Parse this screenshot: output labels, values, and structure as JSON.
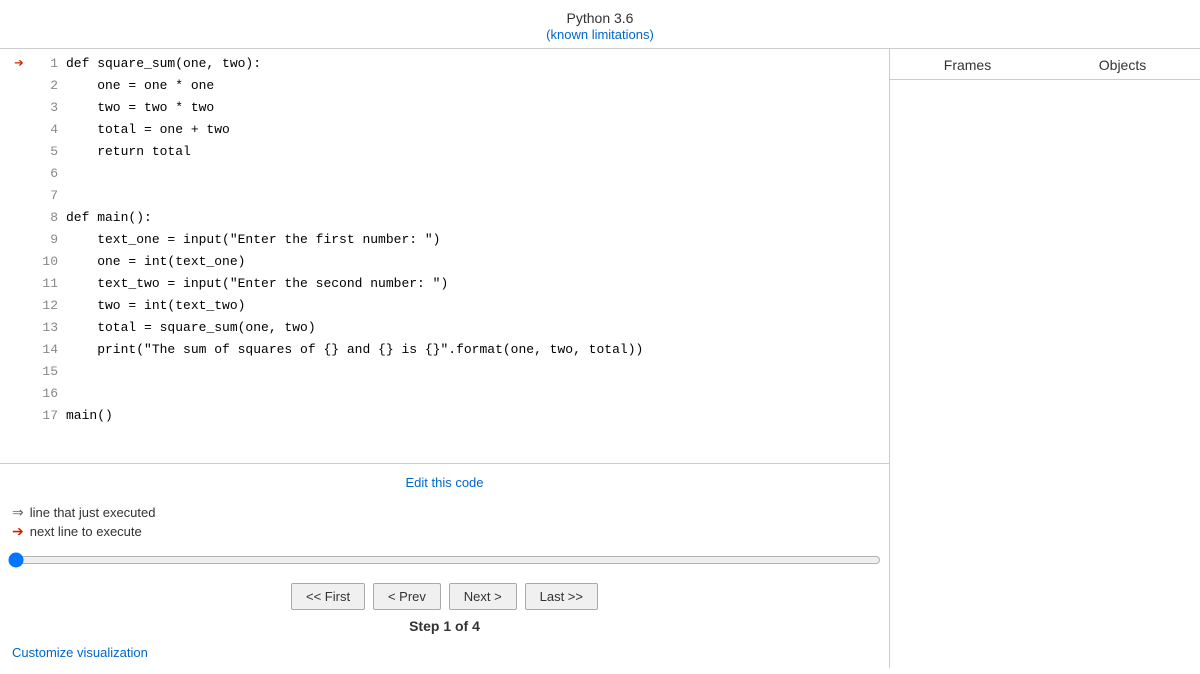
{
  "header": {
    "title": "Python 3.6",
    "limitations_label": "(known limitations)"
  },
  "right_panel": {
    "tab_frames": "Frames",
    "tab_objects": "Objects"
  },
  "code": {
    "lines": [
      {
        "num": 1,
        "content": "def square_sum(one, two):",
        "arrow": "red",
        "id": "line-1"
      },
      {
        "num": 2,
        "content": "    one = one * one",
        "arrow": "",
        "id": "line-2"
      },
      {
        "num": 3,
        "content": "    two = two * two",
        "arrow": "",
        "id": "line-3"
      },
      {
        "num": 4,
        "content": "    total = one + two",
        "arrow": "",
        "id": "line-4"
      },
      {
        "num": 5,
        "content": "    return total",
        "arrow": "",
        "id": "line-5"
      },
      {
        "num": 6,
        "content": "",
        "arrow": "",
        "id": "line-6"
      },
      {
        "num": 7,
        "content": "",
        "arrow": "",
        "id": "line-7"
      },
      {
        "num": 8,
        "content": "def main():",
        "arrow": "",
        "id": "line-8"
      },
      {
        "num": 9,
        "content": "    text_one = input(\"Enter the first number: \")",
        "arrow": "",
        "id": "line-9"
      },
      {
        "num": 10,
        "content": "    one = int(text_one)",
        "arrow": "",
        "id": "line-10"
      },
      {
        "num": 11,
        "content": "    text_two = input(\"Enter the second number: \")",
        "arrow": "",
        "id": "line-11"
      },
      {
        "num": 12,
        "content": "    two = int(text_two)",
        "arrow": "",
        "id": "line-12"
      },
      {
        "num": 13,
        "content": "    total = square_sum(one, two)",
        "arrow": "",
        "id": "line-13"
      },
      {
        "num": 14,
        "content": "    print(\"The sum of squares of {} and {} is {}\".format(one, two, total))",
        "arrow": "",
        "id": "line-14"
      },
      {
        "num": 15,
        "content": "",
        "arrow": "",
        "id": "line-15"
      },
      {
        "num": 16,
        "content": "",
        "arrow": "",
        "id": "line-16"
      },
      {
        "num": 17,
        "content": "main()",
        "arrow": "",
        "id": "line-17"
      }
    ]
  },
  "edit_link": "Edit this code",
  "legend": {
    "outline_label": "line that just executed",
    "solid_label": "next line to execute"
  },
  "nav": {
    "first_label": "<< First",
    "prev_label": "< Prev",
    "next_label": "Next >",
    "last_label": "Last >>"
  },
  "step": {
    "label": "Step 1 of 4",
    "current": 1,
    "total": 4
  },
  "customize_label": "Customize visualization"
}
